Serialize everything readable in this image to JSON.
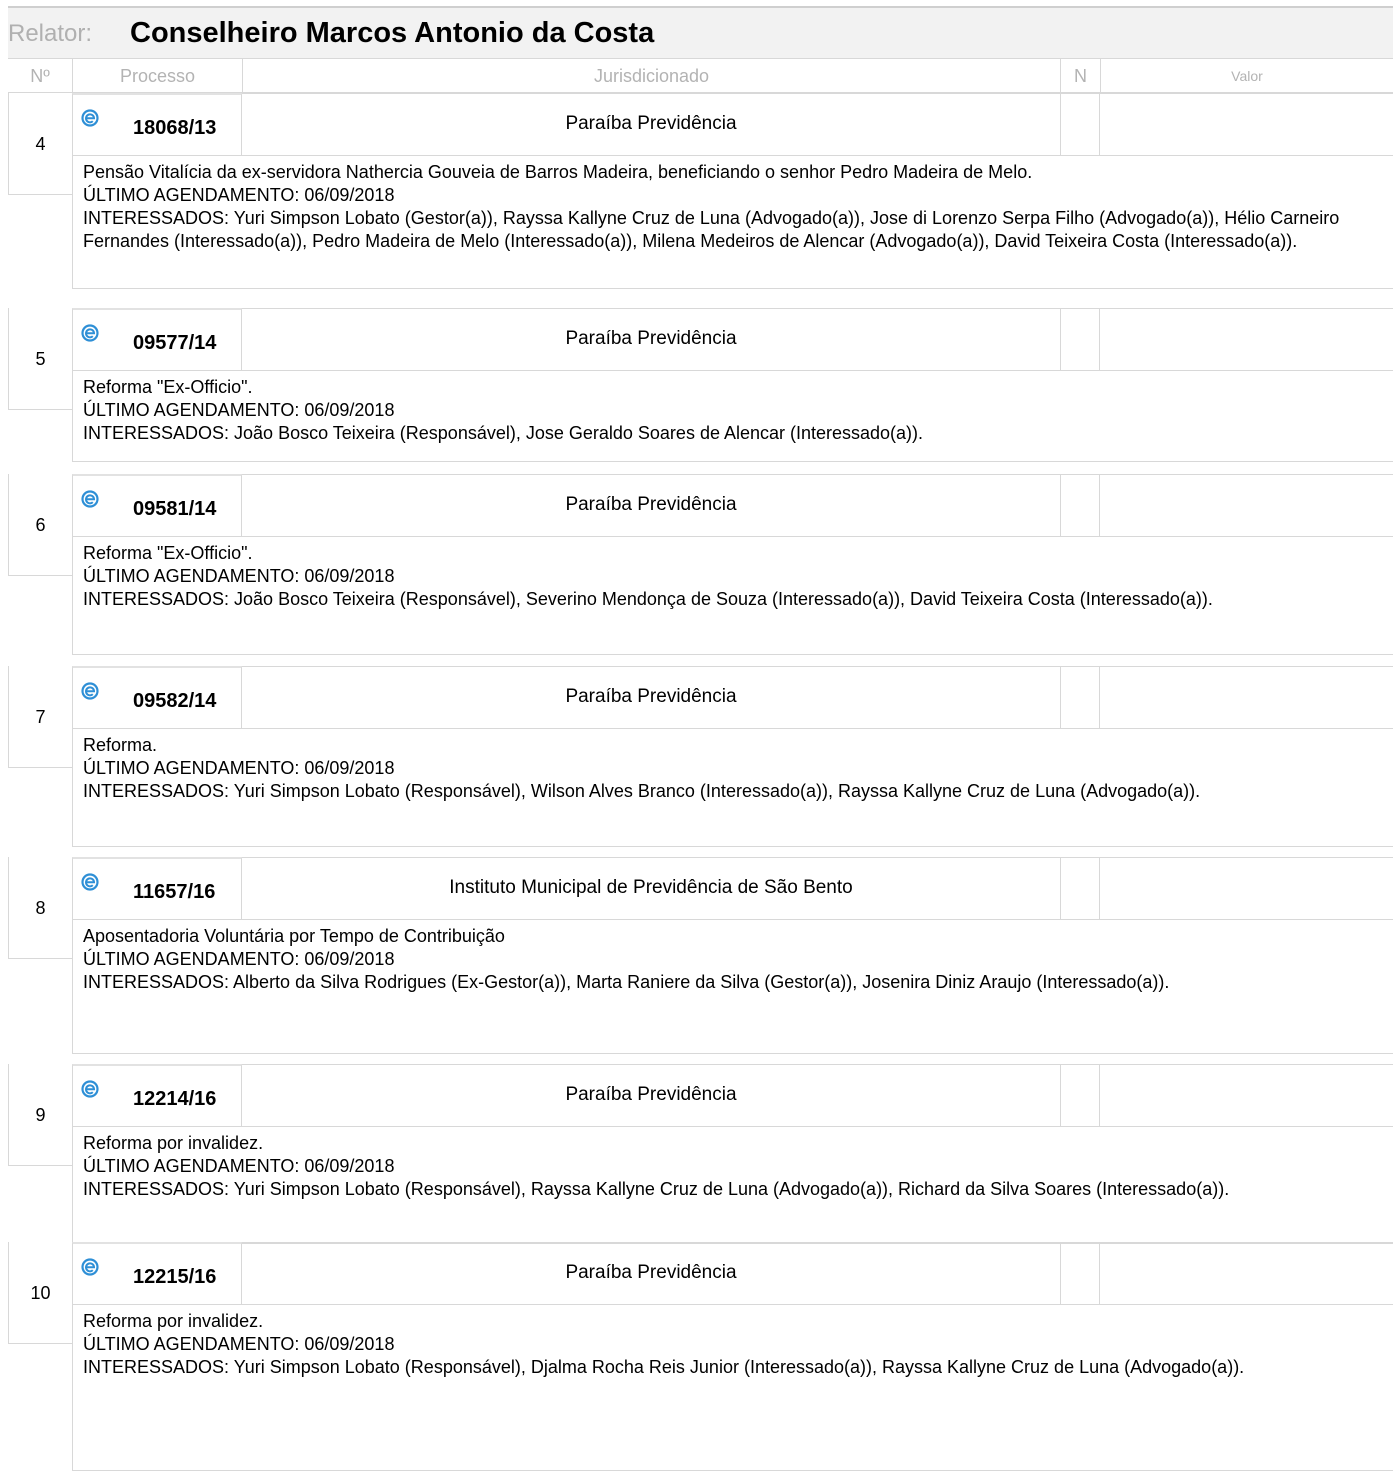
{
  "relator": {
    "label": "Relator:",
    "name": "Conselheiro Marcos Antonio da Costa"
  },
  "columns": {
    "num": "Nº",
    "processo": "Processo",
    "jurisdicionado": "Jurisdicionado",
    "n": "N",
    "valor": "Valor"
  },
  "entries": [
    {
      "num": "4",
      "processo": "18068/13",
      "jurisdicionado": "Paraíba Previdência",
      "description": "Pensão Vitalícia da ex-servidora Nathercia Gouveia de Barros Madeira, beneficiando o senhor Pedro Madeira de Melo.",
      "agendamento": "ÚLTIMO AGENDAMENTO: 06/09/2018",
      "interessados": "INTERESSADOS: Yuri Simpson Lobato (Gestor(a)), Rayssa Kallyne Cruz de Luna (Advogado(a)), Jose di Lorenzo Serpa Filho (Advogado(a)), Hélio Carneiro Fernandes (Interessado(a)), Pedro Madeira de Melo (Interessado(a)), Milena Medeiros de Alencar (Advogado(a)), David Teixeira Costa (Interessado(a))."
    },
    {
      "num": "5",
      "processo": "09577/14",
      "jurisdicionado": "Paraíba Previdência",
      "description": "Reforma \"Ex-Officio\".",
      "agendamento": "ÚLTIMO AGENDAMENTO: 06/09/2018",
      "interessados": "INTERESSADOS: João Bosco Teixeira (Responsável), Jose Geraldo Soares de Alencar (Interessado(a))."
    },
    {
      "num": "6",
      "processo": "09581/14",
      "jurisdicionado": "Paraíba Previdência",
      "description": "Reforma \"Ex-Officio\".",
      "agendamento": "ÚLTIMO AGENDAMENTO: 06/09/2018",
      "interessados": "INTERESSADOS: João Bosco Teixeira (Responsável), Severino Mendonça de Souza (Interessado(a)), David Teixeira Costa (Interessado(a))."
    },
    {
      "num": "7",
      "processo": "09582/14",
      "jurisdicionado": "Paraíba Previdência",
      "description": "Reforma.",
      "agendamento": "ÚLTIMO AGENDAMENTO: 06/09/2018",
      "interessados": "INTERESSADOS: Yuri Simpson Lobato (Responsável), Wilson Alves Branco (Interessado(a)), Rayssa Kallyne Cruz de Luna (Advogado(a))."
    },
    {
      "num": "8",
      "processo": "11657/16",
      "jurisdicionado": "Instituto Municipal de Previdência de São Bento",
      "description": "Aposentadoria Voluntária por Tempo de Contribuição",
      "agendamento": "ÚLTIMO AGENDAMENTO: 06/09/2018",
      "interessados": "INTERESSADOS: Alberto da Silva Rodrigues (Ex-Gestor(a)), Marta Raniere da Silva (Gestor(a)), Josenira Diniz Araujo (Interessado(a))."
    },
    {
      "num": "9",
      "processo": "12214/16",
      "jurisdicionado": "Paraíba Previdência",
      "description": "Reforma por invalidez.",
      "agendamento": "ÚLTIMO AGENDAMENTO: 06/09/2018",
      "interessados": "INTERESSADOS: Yuri Simpson Lobato (Responsável), Rayssa Kallyne Cruz de Luna (Advogado(a)), Richard da Silva Soares (Interessado(a))."
    },
    {
      "num": "10",
      "processo": "12215/16",
      "jurisdicionado": "Paraíba Previdência",
      "description": "Reforma por invalidez.",
      "agendamento": "ÚLTIMO AGENDAMENTO: 06/09/2018",
      "interessados": "INTERESSADOS: Yuri Simpson Lobato (Responsável), Djalma Rocha Reis Junior (Interessado(a)), Rayssa Kallyne Cruz de Luna (Advogado(a))."
    }
  ],
  "icons": {
    "processo_link_icon": "document-link-icon"
  },
  "colors": {
    "icon_blue": "#2e8fd6"
  }
}
